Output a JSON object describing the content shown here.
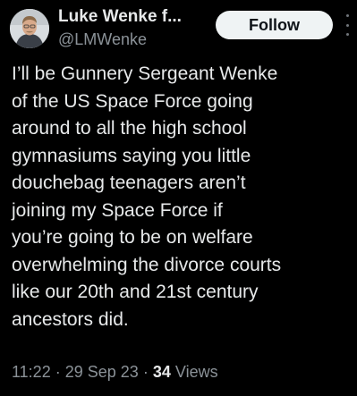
{
  "author": {
    "name": "Luke Wenke f...",
    "handle": "@LMWenke"
  },
  "follow_button": {
    "label": "Follow"
  },
  "more_menu": {
    "icon": "more-vertical-icon"
  },
  "tweet": {
    "lines": [
      "I’ll be Gunnery Sergeant Wenke",
      "of the US Space Force going",
      "around to all the high school",
      "gymnasiums saying you little",
      "douchebag teenagers aren’t",
      "joining my Space Force if",
      "you’re going to be on welfare",
      "overwhelming the divorce courts",
      "like our 20th and 21st century",
      "ancestors did."
    ]
  },
  "meta": {
    "time": "11:22",
    "separator": "·",
    "date": "29 Sep 23",
    "views_count": "34",
    "views_label": "Views"
  },
  "colors": {
    "background": "#000000",
    "text_primary": "#e7e9ea",
    "text_secondary": "#8b9298",
    "follow_bg": "#eff3f4",
    "follow_text": "#0f1419"
  }
}
